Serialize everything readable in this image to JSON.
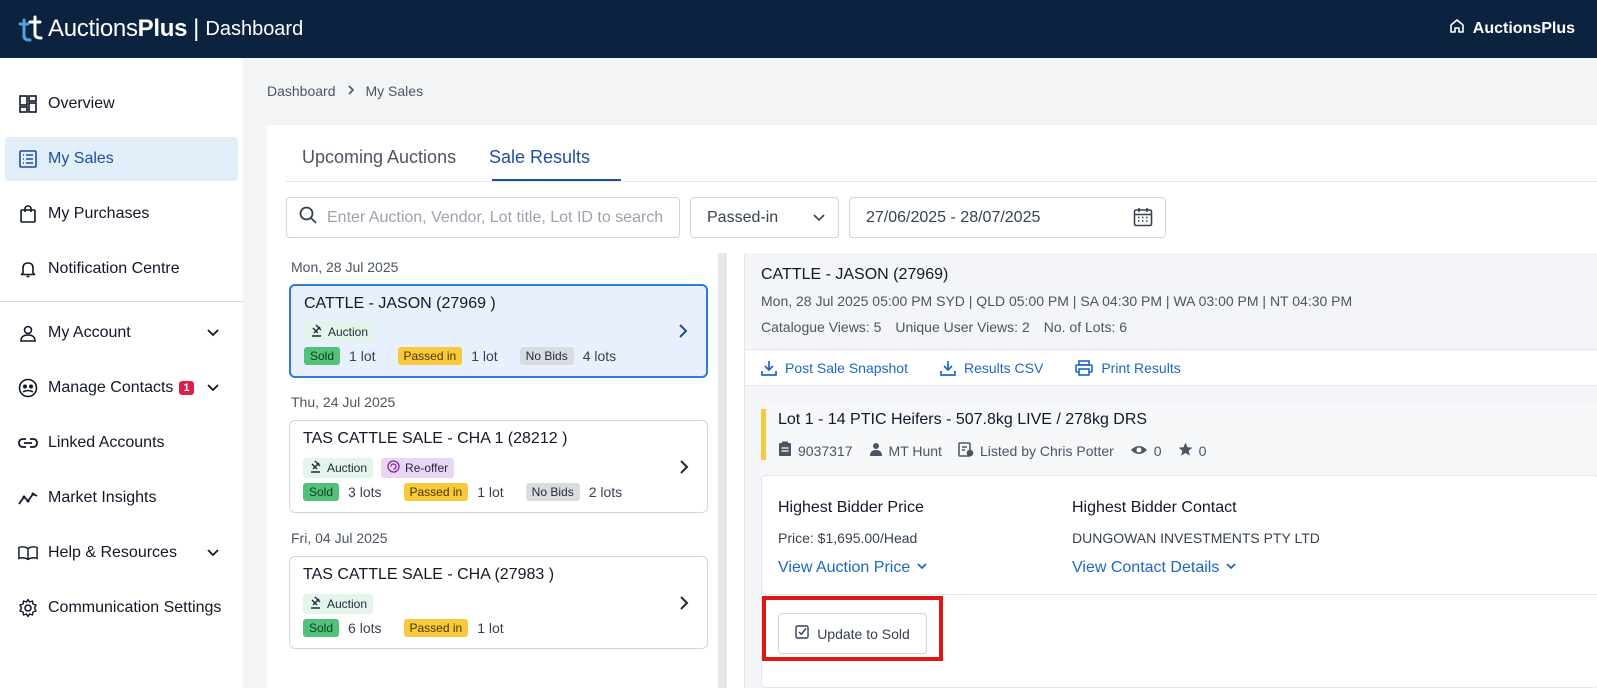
{
  "header": {
    "logo_name": "Auctions",
    "logo_bold": "Plus",
    "section": "Dashboard",
    "right_label": "AuctionsPlus",
    "bg_color": "#0c2340"
  },
  "sidebar": {
    "items": [
      {
        "label": "Overview",
        "icon": "dashboard-icon"
      },
      {
        "label": "My Sales",
        "icon": "list-icon",
        "active": true
      },
      {
        "label": "My Purchases",
        "icon": "shopping-bag-icon"
      },
      {
        "label": "Notification Centre",
        "icon": "bell-icon"
      },
      {
        "label": "My Account",
        "icon": "user-icon",
        "expandable": true
      },
      {
        "label": "Manage Contacts",
        "icon": "contacts-icon",
        "badge": "1",
        "expandable": true
      },
      {
        "label": "Linked Accounts",
        "icon": "link-icon"
      },
      {
        "label": "Market Insights",
        "icon": "trend-icon"
      },
      {
        "label": "Help & Resources",
        "icon": "book-icon",
        "expandable": true
      },
      {
        "label": "Communication Settings",
        "icon": "gear-icon"
      }
    ]
  },
  "breadcrumb": {
    "root": "Dashboard",
    "current": "My Sales"
  },
  "tabs": [
    {
      "label": "Upcoming Auctions"
    },
    {
      "label": "Sale Results",
      "active": true
    }
  ],
  "filters": {
    "search_placeholder": "Enter Auction, Vendor, Lot title, Lot ID to search",
    "status_selected": "Passed-in",
    "date_range": "27/06/2025 - 28/07/2025"
  },
  "sales": [
    {
      "date": "Mon, 28 Jul 2025",
      "title": "CATTLE - JASON (27969 )",
      "tags": [
        "Auction"
      ],
      "sold_label": "Sold",
      "sold": "1 lot",
      "passed_label": "Passed in",
      "passed": "1 lot",
      "nobids_label": "No Bids",
      "nobids": "4 lots",
      "active": true
    },
    {
      "date": "Thu, 24 Jul 2025",
      "title": "TAS CATTLE SALE - CHA 1 (28212 )",
      "tags": [
        "Auction",
        "Re-offer"
      ],
      "sold_label": "Sold",
      "sold": "3 lots",
      "passed_label": "Passed in",
      "passed": "1 lot",
      "nobids_label": "No Bids",
      "nobids": "2 lots"
    },
    {
      "date": "Fri, 04 Jul 2025",
      "title": "TAS CATTLE SALE - CHA (27983 )",
      "tags": [
        "Auction"
      ],
      "sold_label": "Sold",
      "sold": "6 lots",
      "passed_label": "Passed in",
      "passed": "1 lot"
    }
  ],
  "detail": {
    "title": "CATTLE - JASON (27969)",
    "schedule": "Mon, 28 Jul 2025 05:00 PM SYD | QLD 05:00 PM | SA 04:30 PM | WA 03:00 PM | NT 04:30 PM",
    "catalogue_views": "Catalogue Views: 5",
    "unique_views": "Unique User Views: 2",
    "lots": "No. of Lots: 6",
    "actions": [
      "Post Sale Snapshot",
      "Results CSV",
      "Print Results"
    ],
    "lot": {
      "title": "Lot 1 - 14 PTIC Heifers - 507.8kg LIVE / 278kg DRS",
      "id": "9037317",
      "location": "MT Hunt",
      "listed_by": "Listed by Chris Potter",
      "views": "0",
      "stars": "0",
      "price_heading": "Highest Bidder Price",
      "price": "Price: $1,695.00/Head",
      "price_link": "View Auction Price",
      "contact_heading": "Highest Bidder Contact",
      "contact": "DUNGOWAN INVESTMENTS PTY LTD",
      "contact_link": "View Contact Details",
      "update_button": "Update to Sold"
    }
  }
}
